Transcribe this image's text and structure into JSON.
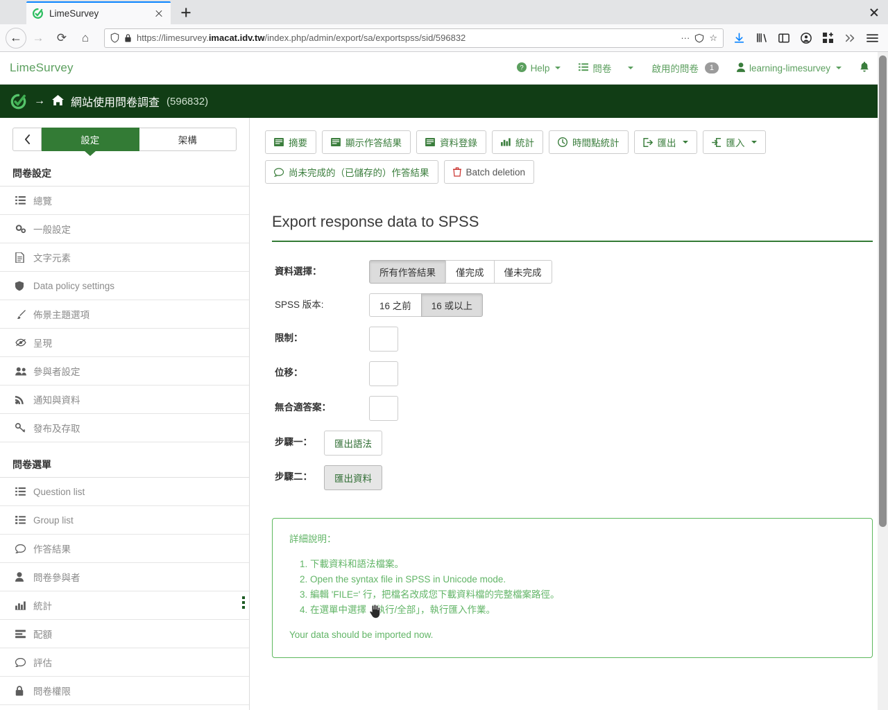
{
  "browser": {
    "tab": {
      "title": "LimeSurvey",
      "favicon": "limesurvey-icon",
      "close": "close-icon"
    },
    "new_tab_label": "+",
    "url": {
      "scheme": "https://",
      "host_pre": "limesurvey.",
      "host_bold": "imacat.idv.tw",
      "path": "/index.php/admin/export/sa/exportspss/sid/596832"
    },
    "nav": {
      "back": "back-arrow",
      "forward": "forward-arrow",
      "reload": "reload-icon",
      "home": "home-icon"
    },
    "toolbar_icons": [
      "download-icon",
      "library-icon",
      "sidebar-icon",
      "account-icon",
      "extensions-icon",
      "overflow-icon",
      "menu-icon"
    ]
  },
  "header": {
    "brand": "LimeSurvey",
    "nav": [
      {
        "label": "Help",
        "icon": "help-icon",
        "caret": true
      },
      {
        "label": "問卷",
        "icon": "list-icon",
        "caret": true
      },
      {
        "label": "啟用的問卷",
        "icon": "",
        "badge": "1"
      },
      {
        "label": "learning-limesurvey",
        "icon": "user-icon",
        "caret": true
      },
      {
        "label": "",
        "icon": "bell-icon"
      }
    ]
  },
  "survey_bar": {
    "logo": "limesurvey-logo",
    "arrow": "→",
    "home_icon": "home-icon",
    "title": "網站使用問卷調查",
    "sid": "(596832)"
  },
  "sidebar": {
    "back_icon": "chevron-left-icon",
    "tabs": [
      {
        "label": "設定",
        "active": true
      },
      {
        "label": "架構",
        "active": false
      }
    ],
    "groups": [
      {
        "heading": "問卷設定",
        "items": [
          {
            "label": "總覽",
            "icon": "list-icon"
          },
          {
            "label": "一般設定",
            "icon": "gears-icon"
          },
          {
            "label": "文字元素",
            "icon": "file-text-icon"
          },
          {
            "label": "Data policy settings",
            "icon": "shield-icon"
          },
          {
            "label": "佈景主題選項",
            "icon": "brush-icon"
          },
          {
            "label": "呈現",
            "icon": "eye-slash-icon"
          },
          {
            "label": "參與者設定",
            "icon": "users-icon"
          },
          {
            "label": "通知與資料",
            "icon": "rss-icon"
          },
          {
            "label": "發布及存取",
            "icon": "key-icon"
          }
        ]
      },
      {
        "heading": "問卷選單",
        "items": [
          {
            "label": "Question list",
            "icon": "list-icon"
          },
          {
            "label": "Group list",
            "icon": "list-ol-icon"
          },
          {
            "label": "作答結果",
            "icon": "comment-icon"
          },
          {
            "label": "問卷參與者",
            "icon": "user-icon"
          },
          {
            "label": "統計",
            "icon": "bar-chart-icon"
          },
          {
            "label": "配額",
            "icon": "tasks-icon"
          },
          {
            "label": "評估",
            "icon": "comment-o-icon"
          },
          {
            "label": "問卷權限",
            "icon": "lock-icon"
          }
        ]
      }
    ]
  },
  "toolbar": {
    "row1": [
      {
        "label": "摘要",
        "icon": "summary-icon"
      },
      {
        "label": "顯示作答結果",
        "icon": "browse-icon"
      },
      {
        "label": "資料登錄",
        "icon": "dataentry-icon"
      },
      {
        "label": "統計",
        "icon": "bar-chart-icon"
      },
      {
        "label": "時間點統計",
        "icon": "clock-icon"
      },
      {
        "label": "匯出",
        "icon": "export-icon",
        "caret": true
      },
      {
        "label": "匯入",
        "icon": "import-icon",
        "caret": true
      }
    ],
    "row2": [
      {
        "label": "尚未完成的（已儲存的）作答結果",
        "icon": "comment-icon",
        "danger": false
      },
      {
        "label": "Batch deletion",
        "icon": "trash-icon",
        "danger": true
      }
    ]
  },
  "panel": {
    "title": "Export response data to SPSS",
    "fields": {
      "data_selection": {
        "label": "資料選擇：",
        "options": [
          {
            "label": "所有作答結果",
            "selected": true
          },
          {
            "label": "僅完成",
            "selected": false
          },
          {
            "label": "僅未完成",
            "selected": false
          }
        ]
      },
      "spss_version": {
        "label": "SPSS 版本:",
        "options": [
          {
            "label": "16 之前",
            "selected": false
          },
          {
            "label": "16 或以上",
            "selected": true
          }
        ]
      },
      "limit": {
        "label": "限制：",
        "value": ""
      },
      "offset": {
        "label": "位移：",
        "value": ""
      },
      "no_answer": {
        "label": "無合適答案：",
        "value": ""
      },
      "step1": {
        "label": "步驟一：",
        "button": "匯出語法"
      },
      "step2": {
        "label": "步驟二：",
        "button": "匯出資料",
        "hover": true
      }
    }
  },
  "info": {
    "title": "詳細說明：",
    "steps": [
      "下載資料和語法檔案。",
      "Open the syntax file in SPSS in Unicode mode.",
      "編輯 'FILE=' 行，把檔名改成您下載資料檔的完整檔案路徑。",
      "在選單中選擇「執行/全部」，執行匯入作業。"
    ],
    "footer": "Your data should be imported now."
  },
  "colors": {
    "brand_green": "#5b9f5e",
    "dark_green": "#113d15",
    "active_green": "#337b35",
    "info_green": "#62b567",
    "danger_red": "#c9302c"
  }
}
